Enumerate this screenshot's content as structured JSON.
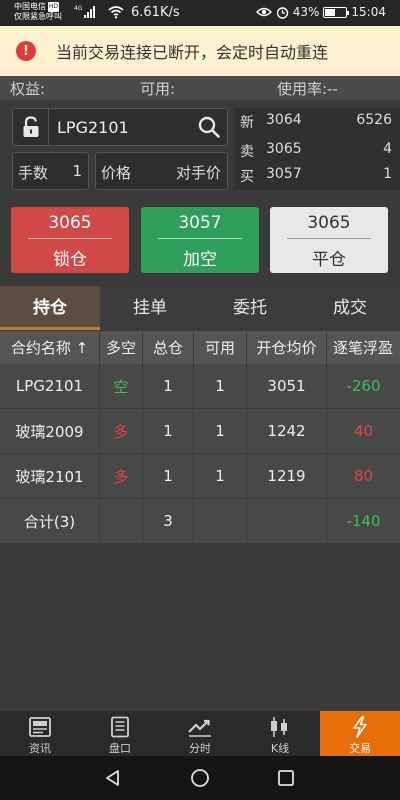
{
  "status_bar": {
    "carrier_line1": "中国电信",
    "carrier_hd": "HD",
    "carrier_line2": "仅限紧急呼叫",
    "network": "4G",
    "speed": "6.61K/s",
    "battery": "43%",
    "battery_level": 0.43,
    "time": "15:04"
  },
  "alert": {
    "icon": "!",
    "message": "当前交易连接已断开，会定时自动重连"
  },
  "account": {
    "equity_label": "权益:",
    "available_label": "可用:",
    "usage_label": "使用率:--"
  },
  "order": {
    "symbol": "LPG2101",
    "qty_label": "手数",
    "qty_value": "1",
    "price_label": "价格",
    "price_value": "对手价"
  },
  "quote": [
    {
      "label": "新",
      "price": "3064",
      "volume": "6526"
    },
    {
      "label": "卖",
      "price": "3065",
      "volume": "4"
    },
    {
      "label": "买",
      "price": "3057",
      "volume": "1"
    }
  ],
  "actions": [
    {
      "price": "3065",
      "label": "锁仓",
      "color": "#d04848"
    },
    {
      "price": "3057",
      "label": "加空",
      "color": "#2e9e5a"
    },
    {
      "price": "3065",
      "label": "平仓",
      "color": "#e8e8e8"
    }
  ],
  "tabs": [
    "持仓",
    "挂单",
    "委托",
    "成交"
  ],
  "positions": {
    "headers": [
      "合约名称 ↑",
      "多空",
      "总仓",
      "可用",
      "开仓均价",
      "逐笔浮盈"
    ],
    "rows": [
      {
        "name": "LPG2101",
        "side": "空",
        "total": "1",
        "avail": "1",
        "avg": "3051",
        "pnl": "-260"
      },
      {
        "name": "玻璃2009",
        "side": "多",
        "total": "1",
        "avail": "1",
        "avg": "1242",
        "pnl": "40"
      },
      {
        "name": "玻璃2101",
        "side": "多",
        "total": "1",
        "avail": "1",
        "avg": "1219",
        "pnl": "80"
      }
    ],
    "total": {
      "name": "合计(3)",
      "total": "3",
      "pnl": "-140"
    }
  },
  "bottom_nav": [
    {
      "label": "资讯",
      "icon": "news-icon"
    },
    {
      "label": "盘口",
      "icon": "order-book-icon"
    },
    {
      "label": "分时",
      "icon": "timeshare-chart-icon"
    },
    {
      "label": "K线",
      "icon": "candlestick-icon"
    },
    {
      "label": "交易",
      "icon": "lightning-icon"
    }
  ],
  "colors": {
    "accent": "#e86e0c",
    "short": "#3dbf5a",
    "long": "#e04545",
    "alert_bg": "#fdf1cf"
  }
}
